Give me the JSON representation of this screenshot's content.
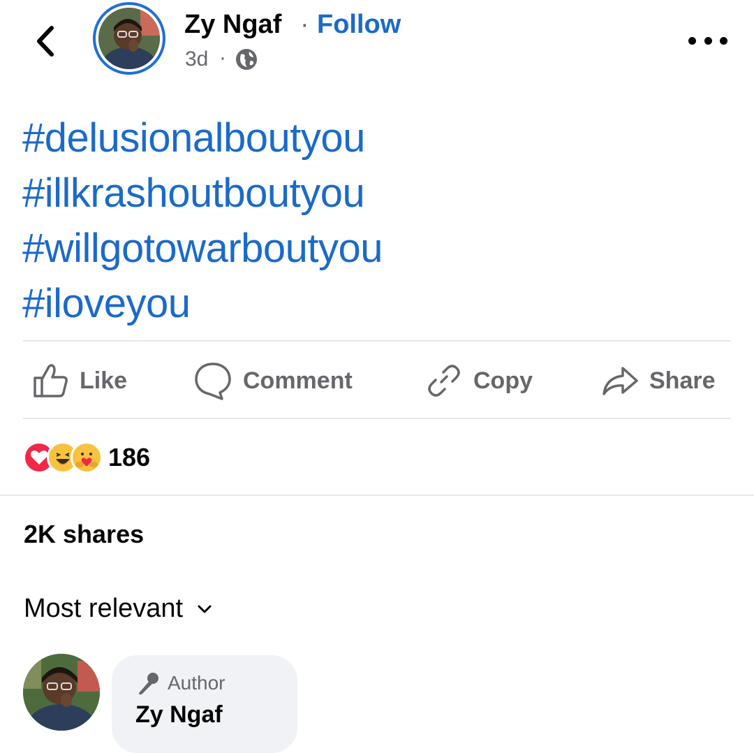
{
  "header": {
    "author_name": "Zy Ngaf",
    "separator": "·",
    "follow_label": "Follow",
    "post_time": "3d",
    "time_separator": "·",
    "audience_icon": "globe-icon"
  },
  "post": {
    "hashtags": [
      "#delusionalboutyou",
      "#illkrashoutboutyou",
      "#willgotowarboutyou",
      "#iloveyou"
    ]
  },
  "actions": {
    "like": "Like",
    "comment": "Comment",
    "copy": "Copy",
    "share": "Share"
  },
  "reactions": {
    "icons": [
      "love-reaction-icon",
      "haha-reaction-icon",
      "care-reaction-icon"
    ],
    "count": "186"
  },
  "shares_text": "2K shares",
  "sort": {
    "label": "Most relevant",
    "icon": "chevron-down-icon"
  },
  "comment": {
    "badge_label": "Author",
    "badge_icon": "microphone-icon",
    "author_name": "Zy Ngaf"
  },
  "colors": {
    "link_blue": "#1b6ac9",
    "avatar_ring": "#1f6fd6",
    "secondary_text": "#65676b",
    "bubble_bg": "#f0f2f5"
  }
}
